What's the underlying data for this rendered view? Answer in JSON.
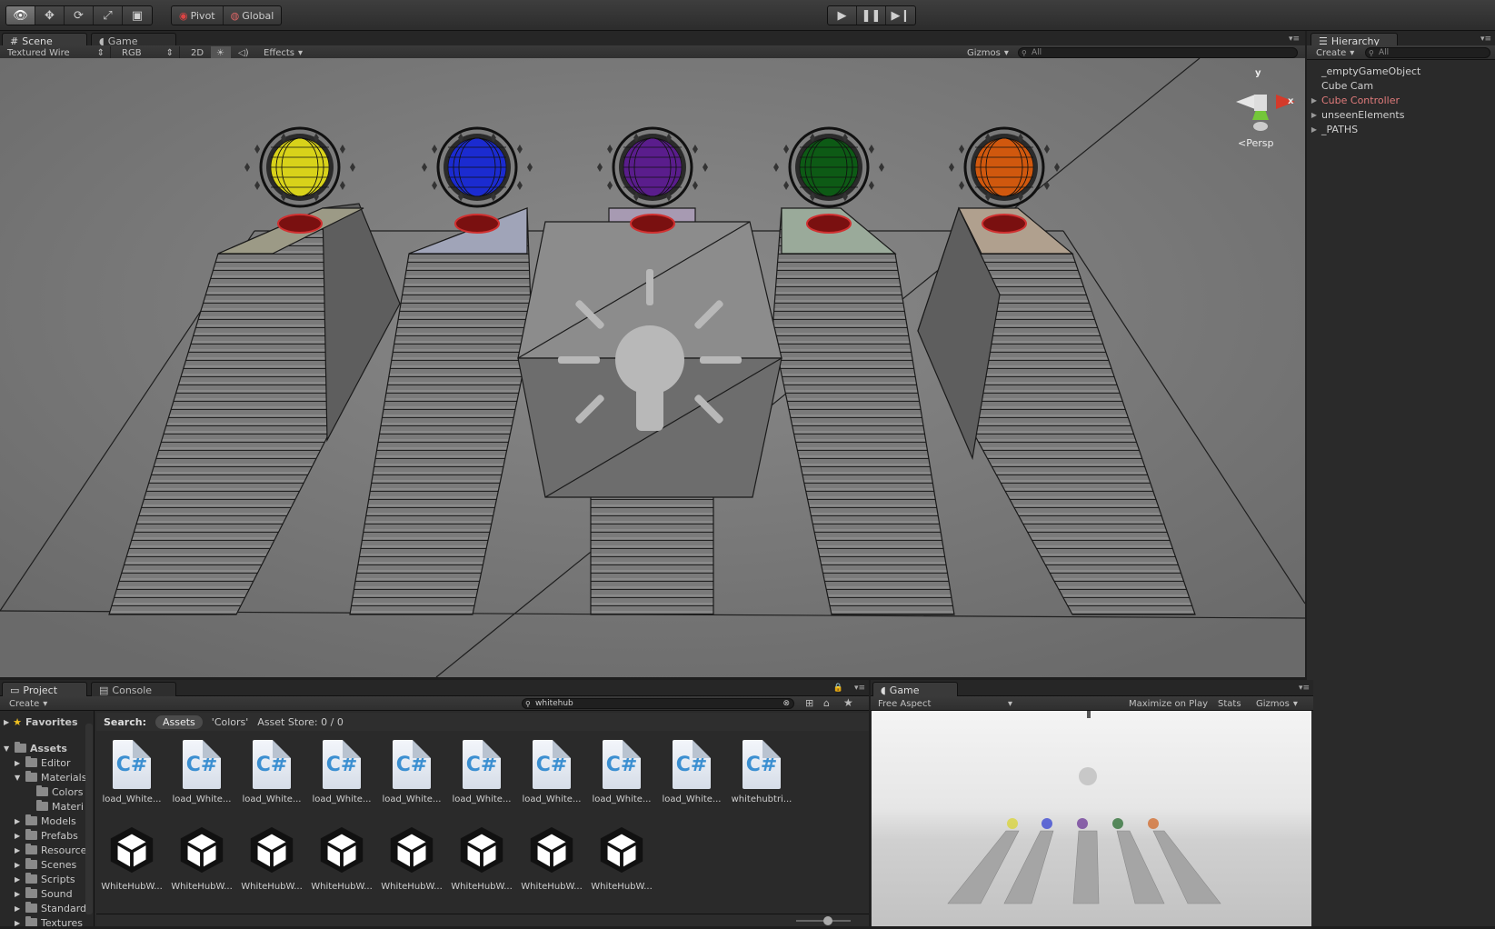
{
  "toolbar": {
    "tools": [
      "view-tool",
      "move-tool",
      "rotate-tool",
      "scale-tool",
      "rect-tool"
    ],
    "pivot_label": "Pivot",
    "global_label": "Global",
    "playback": [
      "play",
      "pause",
      "step"
    ]
  },
  "scene_panel": {
    "tabs": [
      {
        "label": "Scene",
        "icon": "grid-icon"
      },
      {
        "label": "Game",
        "icon": "pacman-icon"
      }
    ],
    "draw_mode": "Textured Wire",
    "render_mode": "RGB",
    "toggle_2d": "2D",
    "effects_label": "Effects",
    "gizmos_label": "Gizmos",
    "search_placeholder": "All",
    "persp_label": "Persp",
    "axis_labels": {
      "y": "y",
      "x": "x"
    }
  },
  "hierarchy": {
    "tab_label": "Hierarchy",
    "create_label": "Create",
    "search_placeholder": "All",
    "items": [
      {
        "label": "_emptyGameObject",
        "expandable": false,
        "color": "#cfcfcf"
      },
      {
        "label": "Cube Cam",
        "expandable": false,
        "color": "#cfcfcf"
      },
      {
        "label": "Cube Controller",
        "expandable": true,
        "color": "#e07b7b"
      },
      {
        "label": "unseenElements",
        "expandable": true,
        "color": "#cfcfcf"
      },
      {
        "label": "_PATHS",
        "expandable": true,
        "color": "#cfcfcf"
      }
    ]
  },
  "project": {
    "tabs": [
      {
        "label": "Project"
      },
      {
        "label": "Console"
      }
    ],
    "create_label": "Create",
    "search_value": "whitehub",
    "search_bar": {
      "label": "Search:",
      "scopes": [
        "Assets",
        "'Colors'",
        "Asset Store: 0 / 0"
      ]
    },
    "favorites_label": "Favorites",
    "tree": [
      {
        "label": "Assets",
        "depth": 0,
        "expanded": true
      },
      {
        "label": "Editor",
        "depth": 1,
        "expanded": false
      },
      {
        "label": "Materials",
        "depth": 1,
        "expanded": true
      },
      {
        "label": "Colors",
        "depth": 2,
        "expanded": false
      },
      {
        "label": "Materi",
        "depth": 2,
        "expanded": false
      },
      {
        "label": "Models",
        "depth": 1,
        "expanded": false
      },
      {
        "label": "Prefabs",
        "depth": 1,
        "expanded": false
      },
      {
        "label": "Resource",
        "depth": 1,
        "expanded": false
      },
      {
        "label": "Scenes",
        "depth": 1,
        "expanded": false
      },
      {
        "label": "Scripts",
        "depth": 1,
        "expanded": false
      },
      {
        "label": "Sound",
        "depth": 1,
        "expanded": false
      },
      {
        "label": "Standard",
        "depth": 1,
        "expanded": false
      },
      {
        "label": "Textures",
        "depth": 1,
        "expanded": false
      }
    ],
    "scripts": [
      "load_White...",
      "load_White...",
      "load_White...",
      "load_White...",
      "load_White...",
      "load_White...",
      "load_White...",
      "load_White...",
      "load_White...",
      "whitehubtri..."
    ],
    "scenes": [
      "WhiteHubW...",
      "WhiteHubW...",
      "WhiteHubW...",
      "WhiteHubW...",
      "WhiteHubW...",
      "WhiteHubW...",
      "WhiteHubW...",
      "WhiteHubW..."
    ]
  },
  "game_panel": {
    "tab_label": "Game",
    "aspect_label": "Free Aspect",
    "maximize_label": "Maximize on Play",
    "stats_label": "Stats",
    "gizmos_label": "Gizmos"
  },
  "scene_objects": {
    "orb_colors": [
      "#d8d21a",
      "#1b2bd0",
      "#5a1d8c",
      "#0d5a15",
      "#d0580e"
    ]
  }
}
